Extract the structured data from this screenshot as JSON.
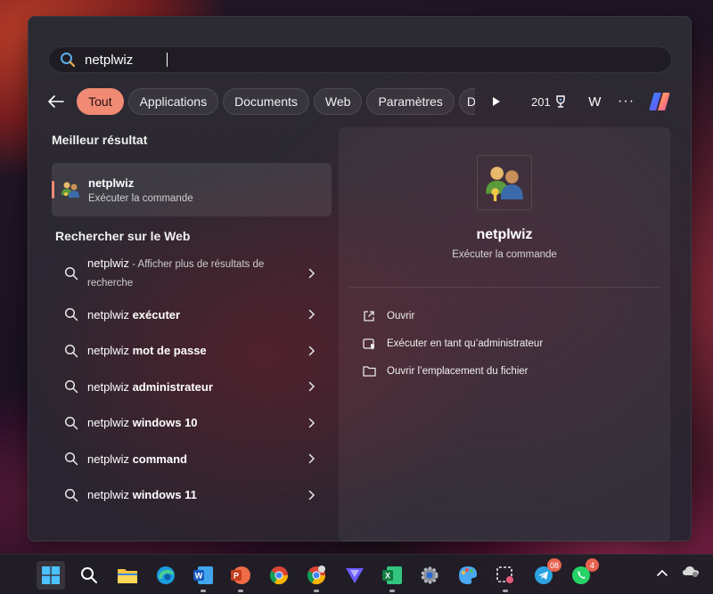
{
  "search": {
    "query": "netplwiz"
  },
  "filters": {
    "tabs": [
      "Tout",
      "Applications",
      "Documents",
      "Web",
      "Paramètres",
      "D"
    ],
    "points": "201",
    "account_initial": "W",
    "more": "···"
  },
  "best_match": {
    "section_title": "Meilleur résultat",
    "name": "netplwiz",
    "subtitle": "Exécuter la commande"
  },
  "web": {
    "section_title": "Rechercher sur le Web",
    "items": [
      {
        "query": "netplwiz",
        "bold": "",
        "hint": " - Afficher plus de résultats de recherche"
      },
      {
        "query": "netplwiz ",
        "bold": "exécuter",
        "hint": ""
      },
      {
        "query": "netplwiz ",
        "bold": "mot de passe",
        "hint": ""
      },
      {
        "query": "netplwiz ",
        "bold": "administrateur",
        "hint": ""
      },
      {
        "query": "netplwiz ",
        "bold": "windows 10",
        "hint": ""
      },
      {
        "query": "netplwiz ",
        "bold": "command",
        "hint": ""
      },
      {
        "query": "netplwiz ",
        "bold": "windows 11",
        "hint": ""
      }
    ]
  },
  "detail": {
    "title": "netplwiz",
    "subtitle": "Exécuter la commande",
    "actions": [
      {
        "label": "Ouvrir",
        "icon": "open-external-icon"
      },
      {
        "label": "Exécuter en tant qu’administrateur",
        "icon": "admin-shield-icon"
      },
      {
        "label": "Ouvrir l’emplacement du fichier",
        "icon": "folder-icon"
      }
    ]
  },
  "taskbar": {
    "icons": [
      "windows-start-icon",
      "search-icon",
      "file-explorer-icon",
      "edge-icon",
      "word-icon",
      "powerpoint-icon",
      "chrome-icon",
      "chrome-profile-icon",
      "vpn-icon",
      "excel-icon",
      "settings-icon",
      "paint-icon",
      "snipping-icon",
      "telegram-icon",
      "whatsapp-icon"
    ],
    "telegram_badge": "08",
    "whatsapp_badge": "4"
  },
  "colors": {
    "accent": "#f08a74",
    "panel": "#2a2630"
  }
}
